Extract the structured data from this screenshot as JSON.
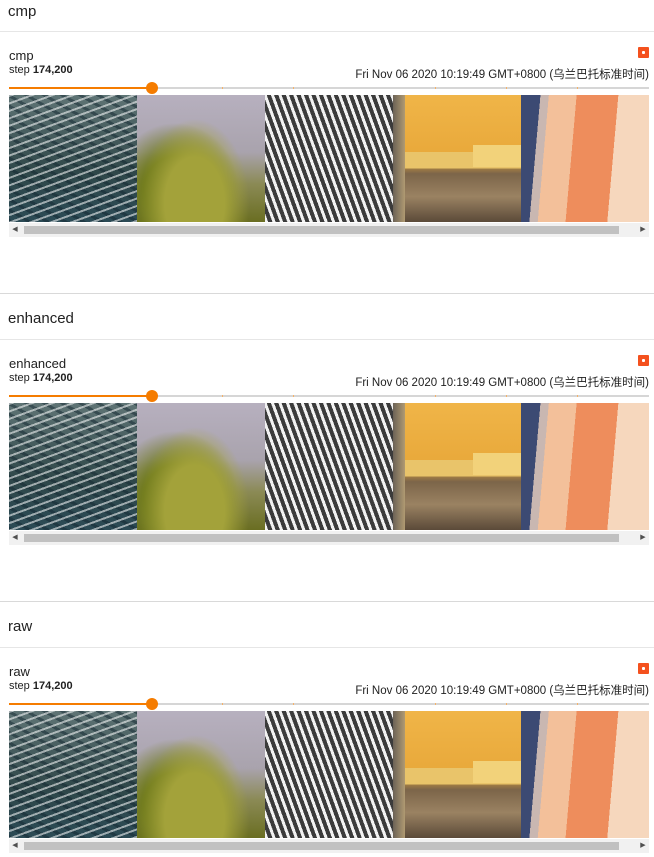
{
  "sections": [
    {
      "title": "cmp",
      "card": {
        "name": "cmp",
        "step_label": "step",
        "step_value": "174,200",
        "timestamp": "Fri Nov 06 2020 10:19:49 GMT+0800 (乌兰巴托标准时间)",
        "slider_fraction": 0.224,
        "images": [
          "water-waves",
          "tree-and-pavement",
          "rope-net",
          "yellow-wall",
          "skin-closeup"
        ]
      }
    },
    {
      "title": "enhanced",
      "card": {
        "name": "enhanced",
        "step_label": "step",
        "step_value": "174,200",
        "timestamp": "Fri Nov 06 2020 10:19:49 GMT+0800 (乌兰巴托标准时间)",
        "slider_fraction": 0.224,
        "images": [
          "water-waves",
          "tree-and-pavement",
          "rope-net",
          "yellow-wall",
          "skin-closeup"
        ]
      }
    },
    {
      "title": "raw",
      "card": {
        "name": "raw",
        "step_label": "step",
        "step_value": "174,200",
        "timestamp": "Fri Nov 06 2020 10:19:49 GMT+0800 (乌兰巴托标准时间)",
        "slider_fraction": 0.224,
        "images": [
          "water-waves",
          "tree-and-pavement",
          "rope-net",
          "yellow-wall",
          "skin-closeup"
        ]
      }
    }
  ],
  "colors": {
    "accent": "#f57c00",
    "expand_icon": "#f4511e"
  },
  "icons": {
    "expand": "fullscreen-icon",
    "scroll_left": "scroll-left-arrow-icon",
    "scroll_right": "scroll-right-arrow-icon"
  }
}
